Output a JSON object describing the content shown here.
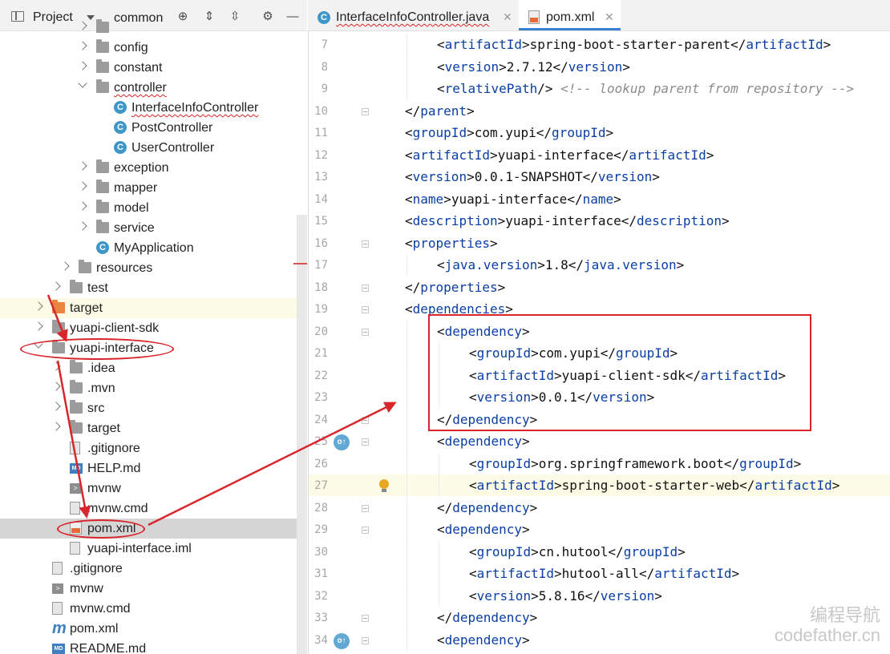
{
  "project_panel": {
    "title": "Project",
    "tree": [
      {
        "label": "common",
        "indent": 6,
        "icon": "folder-icon",
        "chev": "r",
        "cut": true
      },
      {
        "label": "config",
        "indent": 6,
        "icon": "folder-icon",
        "chev": "r"
      },
      {
        "label": "constant",
        "indent": 6,
        "icon": "folder-icon",
        "chev": "r"
      },
      {
        "label": "controller",
        "indent": 6,
        "icon": "folder-icon",
        "chev": "d",
        "wavy": true
      },
      {
        "label": "InterfaceInfoController",
        "indent": 8,
        "icon": "class-icon",
        "wavy": true
      },
      {
        "label": "PostController",
        "indent": 8,
        "icon": "class-icon"
      },
      {
        "label": "UserController",
        "indent": 8,
        "icon": "class-icon"
      },
      {
        "label": "exception",
        "indent": 6,
        "icon": "folder-icon",
        "chev": "r"
      },
      {
        "label": "mapper",
        "indent": 6,
        "icon": "folder-icon",
        "chev": "r"
      },
      {
        "label": "model",
        "indent": 6,
        "icon": "folder-icon",
        "chev": "r"
      },
      {
        "label": "service",
        "indent": 6,
        "icon": "folder-icon",
        "chev": "r"
      },
      {
        "label": "MyApplication",
        "indent": 6,
        "icon": "spring-class-icon"
      },
      {
        "label": "resources",
        "indent": 4,
        "icon": "resources-folder-icon",
        "chev": "r"
      },
      {
        "label": "test",
        "indent": 3,
        "icon": "folder-icon",
        "chev": "r"
      },
      {
        "label": "target",
        "indent": 1,
        "icon": "target-folder-icon",
        "chev": "r",
        "hl": "y"
      },
      {
        "label": "yuapi-client-sdk",
        "indent": 1,
        "icon": "module-folder-icon",
        "chev": "r"
      },
      {
        "label": "yuapi-interface",
        "indent": 1,
        "icon": "module-folder-icon",
        "chev": "d"
      },
      {
        "label": ".idea",
        "indent": 3,
        "icon": "folder-icon",
        "chev": "r"
      },
      {
        "label": ".mvn",
        "indent": 3,
        "icon": "folder-icon",
        "chev": "r"
      },
      {
        "label": "src",
        "indent": 3,
        "icon": "folder-icon",
        "chev": "r"
      },
      {
        "label": "target",
        "indent": 3,
        "icon": "folder-icon",
        "chev": "r"
      },
      {
        "label": ".gitignore",
        "indent": 3,
        "icon": "gitignore-file-icon"
      },
      {
        "label": "HELP.md",
        "indent": 3,
        "icon": "markdown-file-icon"
      },
      {
        "label": "mvnw",
        "indent": 3,
        "icon": "shell-file-icon"
      },
      {
        "label": "mvnw.cmd",
        "indent": 3,
        "icon": "cmd-file-icon"
      },
      {
        "label": "pom.xml",
        "indent": 3,
        "icon": "xml-file-icon",
        "hl": "g"
      },
      {
        "label": "yuapi-interface.iml",
        "indent": 3,
        "icon": "iml-file-icon"
      },
      {
        "label": ".gitignore",
        "indent": 1,
        "icon": "gitignore-file-icon"
      },
      {
        "label": "mvnw",
        "indent": 1,
        "icon": "shell-file-icon"
      },
      {
        "label": "mvnw.cmd",
        "indent": 1,
        "icon": "cmd-file-icon"
      },
      {
        "label": "pom.xml",
        "indent": 1,
        "icon": "maven-file-icon"
      },
      {
        "label": "README.md",
        "indent": 1,
        "icon": "markdown-file-icon"
      }
    ]
  },
  "editor": {
    "tabs": [
      {
        "label": "InterfaceInfoController.java",
        "icon": "class-icon",
        "active": false
      },
      {
        "label": "pom.xml",
        "icon": "xml-file-icon",
        "active": true
      }
    ],
    "lines": [
      {
        "n": "7",
        "indent": 1,
        "text": "<artifactId>spring-boot-starter-parent</artifactId>"
      },
      {
        "n": "8",
        "indent": 1,
        "text": "<version>2.7.12</version>"
      },
      {
        "n": "9",
        "indent": 1,
        "text": "<relativePath/> <!-- lookup parent from repository -->"
      },
      {
        "n": "10",
        "indent": 0,
        "text": "</parent>",
        "fold": true
      },
      {
        "n": "11",
        "indent": 0,
        "text": "<groupId>com.yupi</groupId>"
      },
      {
        "n": "12",
        "indent": 0,
        "text": "<artifactId>yuapi-interface</artifactId>"
      },
      {
        "n": "13",
        "indent": 0,
        "text": "<version>0.0.1-SNAPSHOT</version>"
      },
      {
        "n": "14",
        "indent": 0,
        "text": "<name>yuapi-interface</name>"
      },
      {
        "n": "15",
        "indent": 0,
        "text": "<description>yuapi-interface</description>"
      },
      {
        "n": "16",
        "indent": 0,
        "text": "<properties>",
        "fold": true
      },
      {
        "n": "17",
        "indent": 1,
        "text": "<java.version>1.8</java.version>"
      },
      {
        "n": "18",
        "indent": 0,
        "text": "</properties>",
        "fold": true
      },
      {
        "n": "19",
        "indent": 0,
        "text": "<dependencies>",
        "fold": true
      },
      {
        "n": "20",
        "indent": 1,
        "text": "<dependency>",
        "fold": true
      },
      {
        "n": "21",
        "indent": 2,
        "text": "<groupId>com.yupi</groupId>"
      },
      {
        "n": "22",
        "indent": 2,
        "text": "<artifactId>yuapi-client-sdk</artifactId>"
      },
      {
        "n": "23",
        "indent": 2,
        "text": "<version>0.0.1</version>"
      },
      {
        "n": "24",
        "indent": 1,
        "text": "</dependency>",
        "fold": true
      },
      {
        "n": "25",
        "indent": 1,
        "text": "<dependency>",
        "fold": true,
        "badge": true
      },
      {
        "n": "26",
        "indent": 2,
        "text": "<groupId>org.springframework.boot</groupId>"
      },
      {
        "n": "27",
        "indent": 2,
        "text": "<artifactId>spring-boot-starter-web</artifactId>",
        "current": true,
        "bulb": true
      },
      {
        "n": "28",
        "indent": 1,
        "text": "</dependency>",
        "fold": true
      },
      {
        "n": "29",
        "indent": 1,
        "text": "<dependency>",
        "fold": true
      },
      {
        "n": "30",
        "indent": 2,
        "text": "<groupId>cn.hutool</groupId>"
      },
      {
        "n": "31",
        "indent": 2,
        "text": "<artifactId>hutool-all</artifactId>"
      },
      {
        "n": "32",
        "indent": 2,
        "text": "<version>5.8.16</version>"
      },
      {
        "n": "33",
        "indent": 1,
        "text": "</dependency>",
        "fold": true
      },
      {
        "n": "34",
        "indent": 1,
        "text": "<dependency>",
        "fold": true,
        "badge": true
      }
    ]
  },
  "watermark": {
    "line1": "编程导航",
    "line2": "codefather.cn"
  },
  "colors": {
    "tag": "#0a3ea5",
    "annotation_red": "#d8262c",
    "selection": "#d6d6d6",
    "current_line": "#fbfbe6"
  }
}
